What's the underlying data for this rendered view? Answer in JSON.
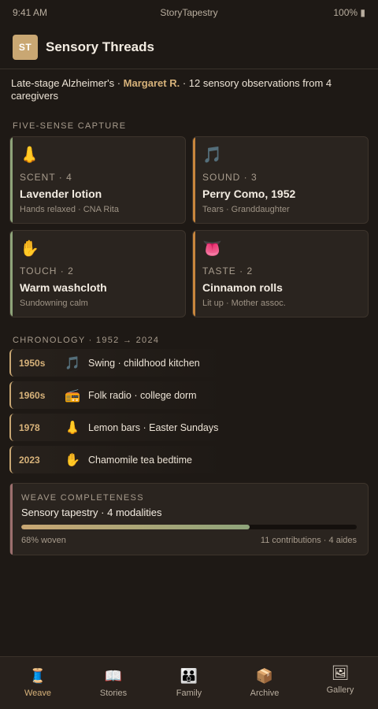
{
  "status_bar": {
    "time": "9:41 AM",
    "app_name": "StoryTapestry",
    "battery": "100% ▮"
  },
  "header": {
    "logo_text": "ST",
    "title": "Sensory Threads"
  },
  "intro": {
    "prefix": "Late-stage Alzheimer's · ",
    "patient": "Margaret R.",
    "suffix": " · 12 sensory observations from 4 caregivers"
  },
  "capture": {
    "label": "FIVE-SENSE CAPTURE",
    "cards": [
      {
        "icon": "👃",
        "meta": "SCENT · 4",
        "item": "Lavender lotion",
        "note": "Hands relaxed · CNA Rita",
        "accent": "#8ea47a"
      },
      {
        "icon": "🎵",
        "meta": "SOUND · 3",
        "item": "Perry Como, 1952",
        "note": "Tears · Granddaughter",
        "accent": "#c8863d"
      },
      {
        "icon": "✋",
        "meta": "TOUCH · 2",
        "item": "Warm washcloth",
        "note": "Sundowning calm",
        "accent": "#8ea47a"
      },
      {
        "icon": "👅",
        "meta": "TASTE · 2",
        "item": "Cinnamon rolls",
        "note": "Lit up · Mother assoc.",
        "accent": "#c8863d"
      }
    ]
  },
  "chronology": {
    "label": "CHRONOLOGY · 1952 → 2024",
    "rows": [
      {
        "year": "1950s",
        "icon": "🎵",
        "desc": "Swing · childhood kitchen"
      },
      {
        "year": "1960s",
        "icon": "📻",
        "desc": "Folk radio · college dorm"
      },
      {
        "year": "1978",
        "icon": "👃",
        "desc": "Lemon bars · Easter Sundays"
      },
      {
        "year": "2023",
        "icon": "✋",
        "desc": "Chamomile tea bedtime"
      }
    ]
  },
  "weave": {
    "label": "WEAVE COMPLETENESS",
    "title": "Sensory tapestry · 4 modalities",
    "progress": 0.68,
    "progress_text": "68% woven",
    "contributions": "11 contributions · 4 aides"
  },
  "tabs": [
    {
      "icon": "🧵",
      "label": "Weave",
      "active": true
    },
    {
      "icon": "📖",
      "label": "Stories",
      "active": false
    },
    {
      "icon": "👪",
      "label": "Family",
      "active": false
    },
    {
      "icon": "📦",
      "label": "Archive",
      "active": false
    },
    {
      "icon": "🖼",
      "label": "Gallery",
      "active": false
    }
  ],
  "colors": {
    "accent_gold": "#d7b27a",
    "accent_green": "#8ea47a",
    "accent_orange": "#c8863d",
    "background": "#1e1915"
  }
}
